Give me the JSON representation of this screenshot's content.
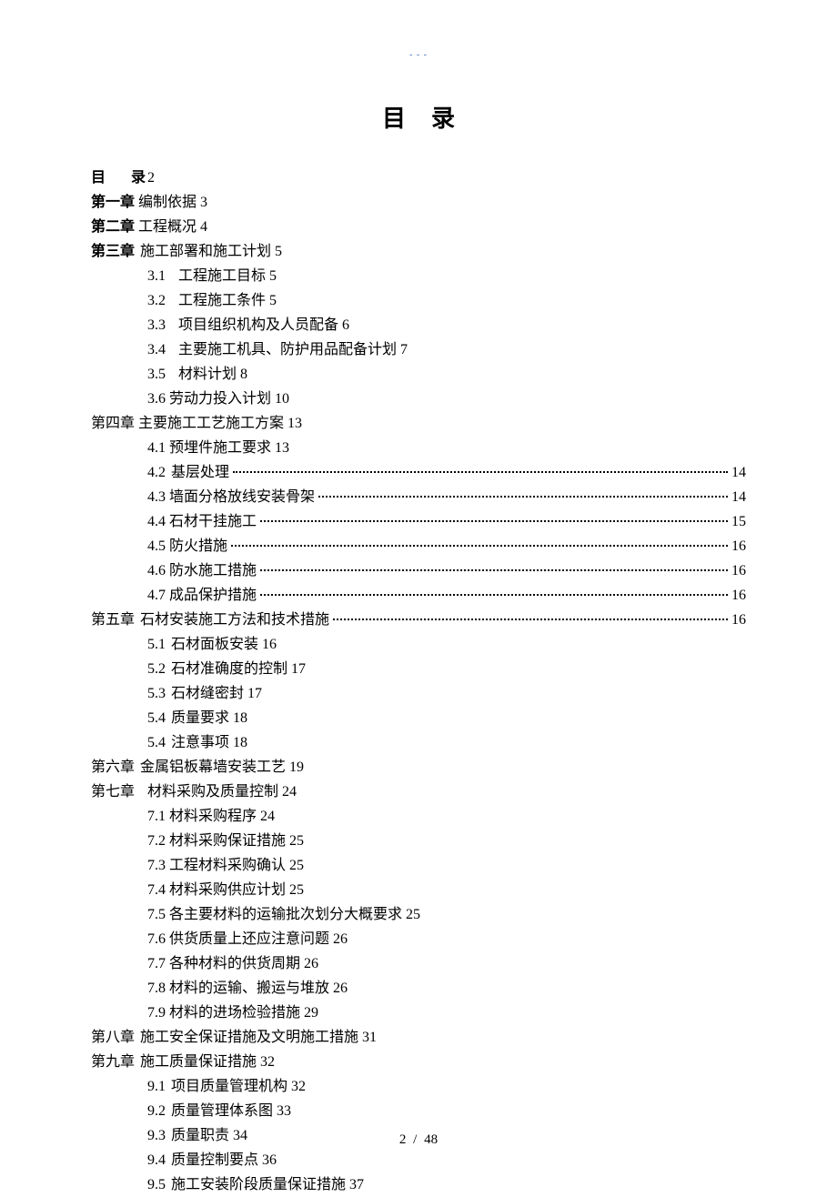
{
  "header_mark": "- - -",
  "title": "目录",
  "toc": {
    "line_mulu": {
      "label": "目",
      "label2": "录",
      "page": "2"
    },
    "ch1": {
      "label": "第一章",
      "title": "编制依据",
      "page": "3"
    },
    "ch2": {
      "label": "第二章",
      "title": "工程概况",
      "page": "4"
    },
    "ch3": {
      "label": "第三章",
      "title": "施工部署和施工计划",
      "page": "5"
    },
    "ch3_s1": {
      "num": "3.1",
      "title": "工程施工目标",
      "page": "5"
    },
    "ch3_s2": {
      "num": "3.2",
      "title": "工程施工条件",
      "page": "5"
    },
    "ch3_s3": {
      "num": "3.3",
      "title": "项目组织机构及人员配备",
      "page": "6"
    },
    "ch3_s4": {
      "num": "3.4",
      "title": "主要施工机具、防护用品配备计划",
      "page": "7"
    },
    "ch3_s5": {
      "num": "3.5",
      "title": "材料计划",
      "page": "8"
    },
    "ch3_s6": {
      "num": "3.6",
      "title": "劳动力投入计划",
      "page": "10"
    },
    "ch4": {
      "label": "第四章",
      "title": "主要施工工艺施工方案",
      "page": "13"
    },
    "ch4_s1": {
      "num": "4.1",
      "title": "预埋件施工要求",
      "page": "13"
    },
    "ch4_s2": {
      "num": "4.2",
      "title": "基层处理",
      "page": "14"
    },
    "ch4_s3": {
      "num": "4.3",
      "title": "墙面分格放线安装骨架",
      "page": "14"
    },
    "ch4_s4": {
      "num": "4.4",
      "title": "石材干挂施工",
      "page": "15"
    },
    "ch4_s5": {
      "num": "4.5",
      "title": "防火措施",
      "page": "16"
    },
    "ch4_s6": {
      "num": "4.6",
      "title": "防水施工措施",
      "page": "16"
    },
    "ch4_s7": {
      "num": "4.7",
      "title": "成品保护措施",
      "page": "16"
    },
    "ch5": {
      "label": "第五章",
      "title": "石材安装施工方法和技术措施",
      "page": "16"
    },
    "ch5_s1": {
      "num": "5.1",
      "title": "石材面板安装",
      "page": "16"
    },
    "ch5_s2": {
      "num": "5.2",
      "title": "石材准确度的控制",
      "page": "17"
    },
    "ch5_s3": {
      "num": "5.3",
      "title": "石材缝密封",
      "page": "17"
    },
    "ch5_s4": {
      "num": "5.4",
      "title": "质量要求",
      "page": "18"
    },
    "ch5_s5": {
      "num": "5.4",
      "title": "注意事项",
      "page": "18"
    },
    "ch6": {
      "label": "第六章",
      "title": "金属铝板幕墙安装工艺",
      "page": "19"
    },
    "ch7": {
      "label": "第七章",
      "title": "材料采购及质量控制",
      "page": "24"
    },
    "ch7_s1": {
      "num": "7.1",
      "title": "材料采购程序",
      "page": "24"
    },
    "ch7_s2": {
      "num": "7.2",
      "title": "材料采购保证措施",
      "page": "25"
    },
    "ch7_s3": {
      "num": "7.3",
      "title": "工程材料采购确认",
      "page": "25"
    },
    "ch7_s4": {
      "num": "7.4",
      "title": "材料采购供应计划",
      "page": "25"
    },
    "ch7_s5": {
      "num": "7.5",
      "title": "各主要材料的运输批次划分大概要求",
      "page": "25"
    },
    "ch7_s6": {
      "num": "7.6",
      "title": "供货质量上还应注意问题",
      "page": "26"
    },
    "ch7_s7": {
      "num": "7.7",
      "title": "各种材料的供货周期",
      "page": "26"
    },
    "ch7_s8": {
      "num": "7.8",
      "title": "材料的运输、搬运与堆放",
      "page": "26"
    },
    "ch7_s9": {
      "num": "7.9",
      "title": "材料的进场检验措施",
      "page": "29"
    },
    "ch8": {
      "label": "第八章",
      "title": "施工安全保证措施及文明施工措施",
      "page": "31"
    },
    "ch9": {
      "label": "第九章",
      "title": "施工质量保证措施",
      "page": "32"
    },
    "ch9_s1": {
      "num": "9.1",
      "title": "项目质量管理机构",
      "page": "32"
    },
    "ch9_s2": {
      "num": "9.2",
      "title": "质量管理体系图",
      "page": "33"
    },
    "ch9_s3": {
      "num": "9.3",
      "title": "质量职责",
      "page": "34"
    },
    "ch9_s4": {
      "num": "9.4",
      "title": "质量控制要点",
      "page": "36"
    },
    "ch9_s5": {
      "num": "9.5",
      "title": "施工安装阶段质量保证措施",
      "page": "37"
    }
  },
  "footer": {
    "current": "2",
    "sep": "/",
    "total": "48"
  }
}
